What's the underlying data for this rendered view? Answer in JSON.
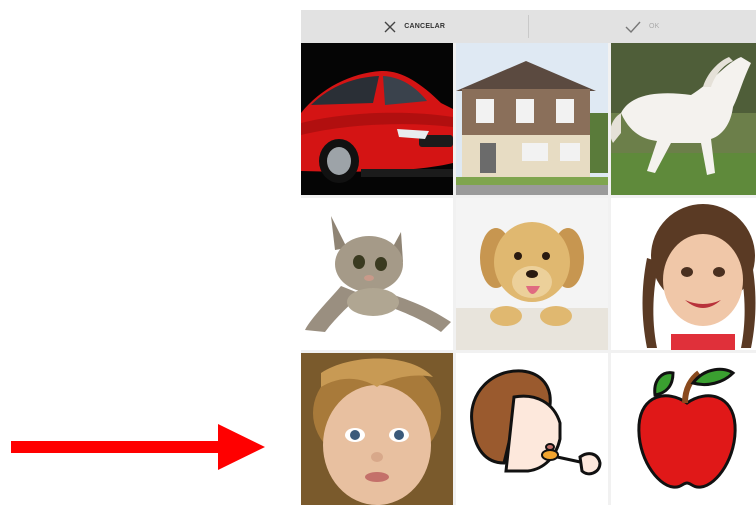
{
  "action_bar": {
    "cancel": {
      "label": "CANCELAR",
      "icon": "close-icon"
    },
    "ok": {
      "label": "OK",
      "icon": "check-icon"
    }
  },
  "grid": {
    "items": [
      {
        "name": "car",
        "color": "#e01818"
      },
      {
        "name": "house",
        "color": "#8a6f5a"
      },
      {
        "name": "horse",
        "color": "#f4f2ee"
      },
      {
        "name": "kitten",
        "color": "#9a8f80"
      },
      {
        "name": "puppy",
        "color": "#e0b870"
      },
      {
        "name": "girl",
        "color": "#f0c7a8"
      },
      {
        "name": "boy",
        "color": "#e8c0a0"
      },
      {
        "name": "eating-pictogram",
        "color": "#9a5a2e"
      },
      {
        "name": "apple",
        "color": "#e01818"
      }
    ]
  },
  "annotation": {
    "arrow_color": "#ff0000"
  }
}
